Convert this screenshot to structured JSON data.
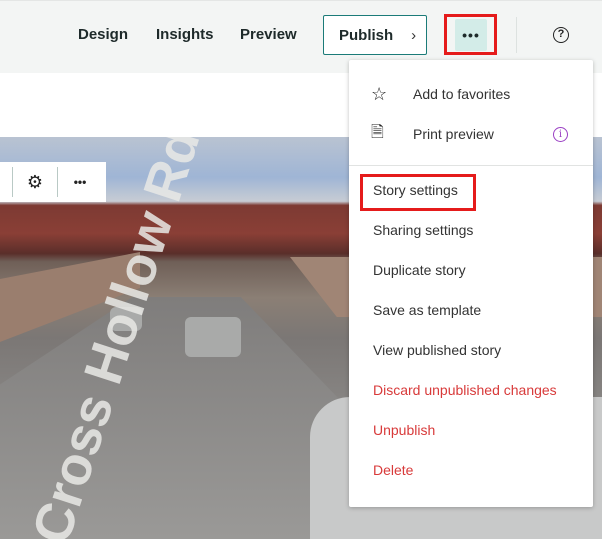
{
  "header": {
    "nav": [
      "Design",
      "Insights",
      "Preview"
    ],
    "publish_label": "Publish",
    "publish_chevron": "›",
    "more_label": "•••",
    "help_label": "?"
  },
  "toolbar": {
    "settings_icon": "⚙",
    "more_label": "•••"
  },
  "photo": {
    "road_text": "Cross Hollow Rd"
  },
  "menu": {
    "top_items": [
      {
        "label": "Add to favorites",
        "icon": "☆"
      },
      {
        "label": "Print preview",
        "icon": "🗎",
        "info": "i"
      }
    ],
    "items": [
      {
        "label": "Story settings",
        "danger": false
      },
      {
        "label": "Sharing settings",
        "danger": false
      },
      {
        "label": "Duplicate story",
        "danger": false
      },
      {
        "label": "Save as template",
        "danger": false
      },
      {
        "label": "View published story",
        "danger": false
      },
      {
        "label": "Discard unpublished changes",
        "danger": true
      },
      {
        "label": "Unpublish",
        "danger": true
      },
      {
        "label": "Delete",
        "danger": true
      }
    ]
  },
  "colors": {
    "accent": "#1b7b78",
    "highlight": "#e51b1b",
    "danger": "#d83a3a",
    "info": "#9a3fc4"
  }
}
